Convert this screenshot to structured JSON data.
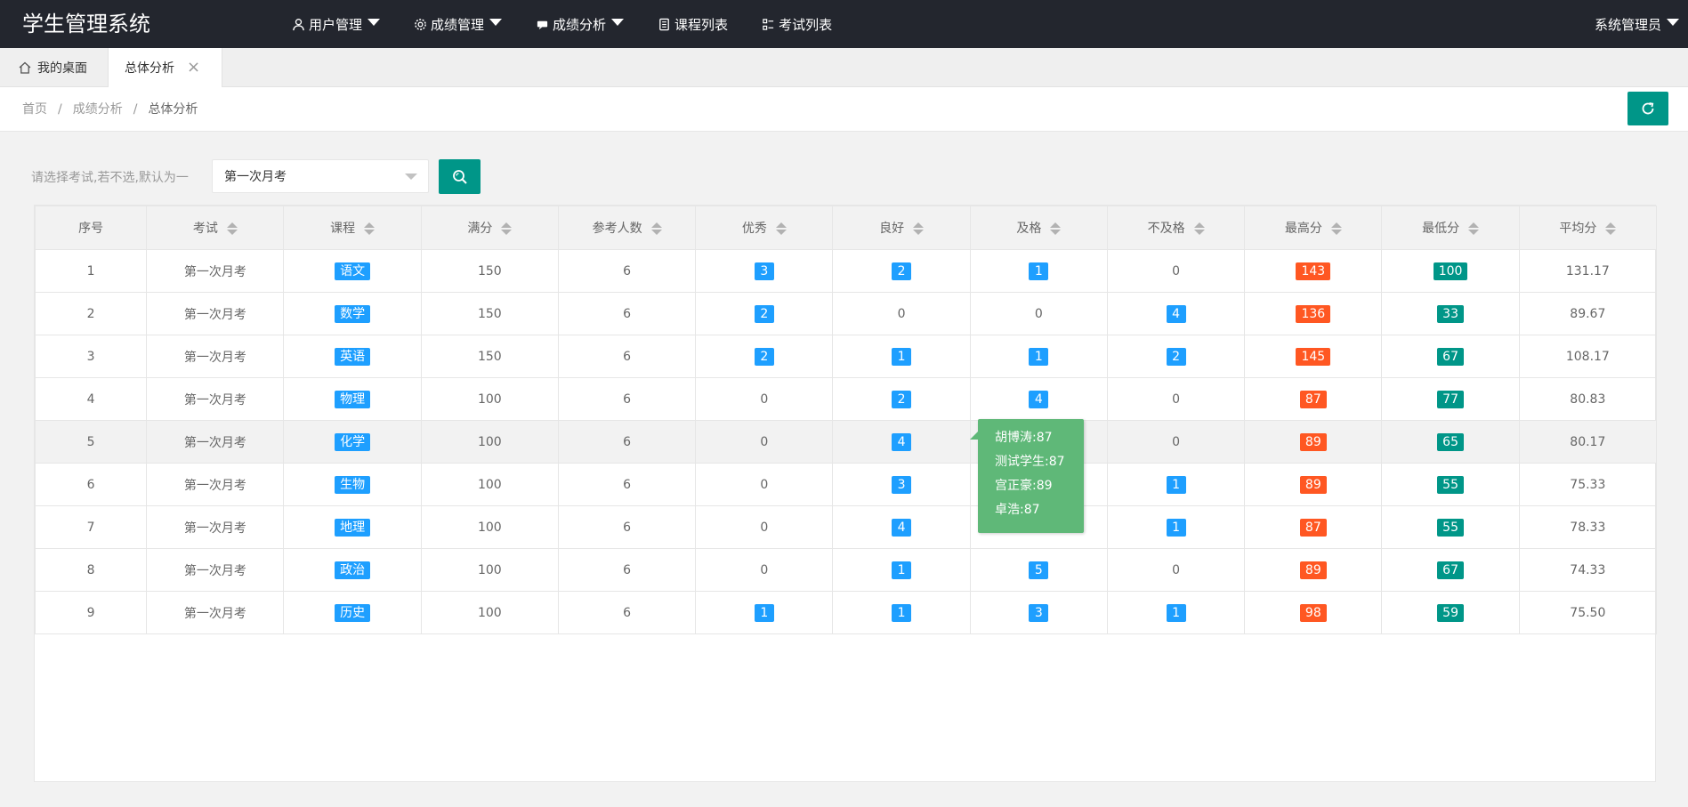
{
  "app": {
    "title": "学生管理系统"
  },
  "nav": [
    {
      "label": "用户管理",
      "icon": "user-icon",
      "dropdown": true
    },
    {
      "label": "成绩管理",
      "icon": "gear-icon",
      "dropdown": true
    },
    {
      "label": "成绩分析",
      "icon": "chat-icon",
      "dropdown": true
    },
    {
      "label": "课程列表",
      "icon": "document-icon",
      "dropdown": false
    },
    {
      "label": "考试列表",
      "icon": "list-icon",
      "dropdown": false
    }
  ],
  "user": {
    "name": "系统管理员"
  },
  "tabs": {
    "home": "我的桌面",
    "active": "总体分析"
  },
  "breadcrumb": {
    "home": "首页",
    "parent": "成绩分析",
    "current": "总体分析",
    "separator": "/"
  },
  "filter": {
    "label": "请选择考试,若不选,默认为一",
    "selected": "第一次月考"
  },
  "table": {
    "headers": [
      "序号",
      "考试",
      "课程",
      "满分",
      "参考人数",
      "优秀",
      "良好",
      "及格",
      "不及格",
      "最高分",
      "最低分",
      "平均分"
    ],
    "rows": [
      [
        "1",
        "第一次月考",
        "语文",
        "150",
        "6",
        "3",
        "2",
        "1",
        "0",
        "143",
        "100",
        "131.17"
      ],
      [
        "2",
        "第一次月考",
        "数学",
        "150",
        "6",
        "2",
        "0",
        "0",
        "4",
        "136",
        "33",
        "89.67"
      ],
      [
        "3",
        "第一次月考",
        "英语",
        "150",
        "6",
        "2",
        "1",
        "1",
        "2",
        "145",
        "67",
        "108.17"
      ],
      [
        "4",
        "第一次月考",
        "物理",
        "100",
        "6",
        "0",
        "2",
        "4",
        "0",
        "87",
        "77",
        "80.83"
      ],
      [
        "5",
        "第一次月考",
        "化学",
        "100",
        "6",
        "0",
        "4",
        "",
        "0",
        "89",
        "65",
        "80.17"
      ],
      [
        "6",
        "第一次月考",
        "生物",
        "100",
        "6",
        "0",
        "3",
        "",
        "1",
        "89",
        "55",
        "75.33"
      ],
      [
        "7",
        "第一次月考",
        "地理",
        "100",
        "6",
        "0",
        "4",
        "",
        "1",
        "87",
        "55",
        "78.33"
      ],
      [
        "8",
        "第一次月考",
        "政治",
        "100",
        "6",
        "0",
        "1",
        "5",
        "0",
        "89",
        "67",
        "74.33"
      ],
      [
        "9",
        "第一次月考",
        "历史",
        "100",
        "6",
        "1",
        "1",
        "3",
        "1",
        "98",
        "59",
        "75.50"
      ]
    ]
  },
  "tooltip": {
    "lines": [
      "胡博涛:87",
      "测试学生:87",
      "宫正豪:89",
      "卓浩:87"
    ]
  },
  "colors": {
    "header_bg": "#23262e",
    "primary": "#009688",
    "blue": "#1e9fff",
    "orange": "#ff5722",
    "tooltip": "#5fb878"
  }
}
